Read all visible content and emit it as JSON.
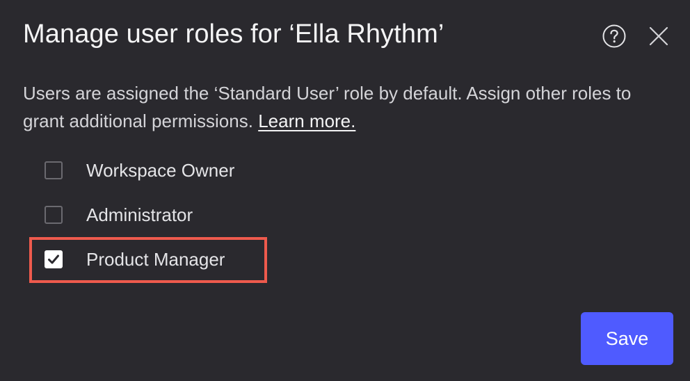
{
  "dialog": {
    "title": "Manage user roles for ‘Ella Rhythm’",
    "description": "Users are assigned the ‘Standard User’ role by default. Assign other roles to grant additional permissions. ",
    "learn_more": "Learn more.",
    "help_icon": "question-circle-icon",
    "close_icon": "close-icon",
    "roles": [
      {
        "label": "Workspace Owner",
        "checked": false
      },
      {
        "label": "Administrator",
        "checked": false
      },
      {
        "label": "Product Manager",
        "checked": true
      }
    ],
    "save_label": "Save"
  },
  "colors": {
    "background": "#2a292e",
    "accent": "#4f5bff",
    "highlight": "#ee5a4d"
  }
}
